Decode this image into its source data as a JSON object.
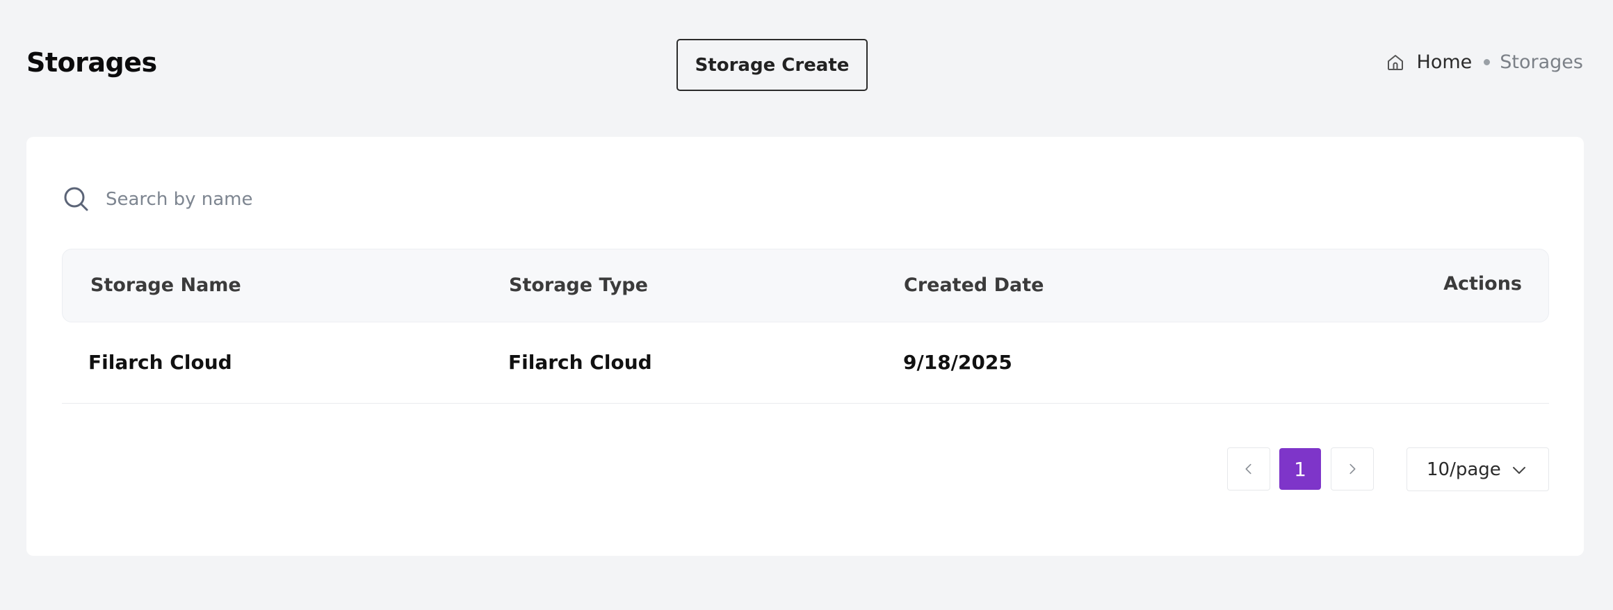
{
  "header": {
    "title": "Storages",
    "create_button": "Storage Create",
    "breadcrumb": {
      "home": "Home",
      "current": "Storages"
    }
  },
  "search": {
    "placeholder": "Search by name",
    "value": ""
  },
  "table": {
    "columns": [
      "Storage Name",
      "Storage Type",
      "Created Date",
      "Actions"
    ],
    "rows": [
      {
        "storage_name": "Filarch Cloud",
        "storage_type": "Filarch Cloud",
        "created_date": "9/18/2025",
        "actions": ""
      }
    ]
  },
  "pagination": {
    "current_page": "1",
    "page_size": "10/page"
  },
  "icons": {
    "home": "home-icon",
    "search": "search-icon",
    "prev": "chevron-left-icon",
    "next": "chevron-right-icon",
    "dropdown": "chevron-down-icon"
  },
  "colors": {
    "accent": "#7e35c9",
    "background": "#f3f4f6",
    "card": "#ffffff"
  }
}
